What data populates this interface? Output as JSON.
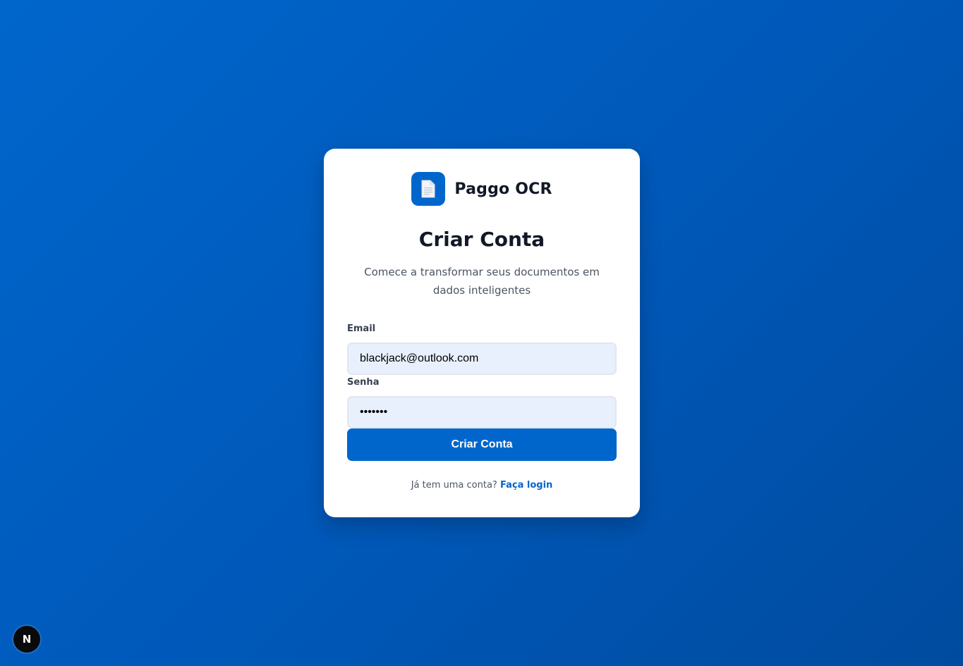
{
  "brand": {
    "name": "Paggo OCR",
    "logo_icon": "document-icon",
    "accent_color": "#0066cc"
  },
  "form": {
    "title": "Criar Conta",
    "subtitle": "Comece a transformar seus documentos em dados inteligentes",
    "email_label": "Email",
    "email_value": "blackjack@outlook.com",
    "password_label": "Senha",
    "password_value": "1234567",
    "submit_label": "Criar Conta"
  },
  "footer": {
    "prompt": "Já tem uma conta?",
    "login_link": "Faça login"
  },
  "dev_badge": {
    "letter": "N",
    "icon": "nextjs-icon"
  }
}
